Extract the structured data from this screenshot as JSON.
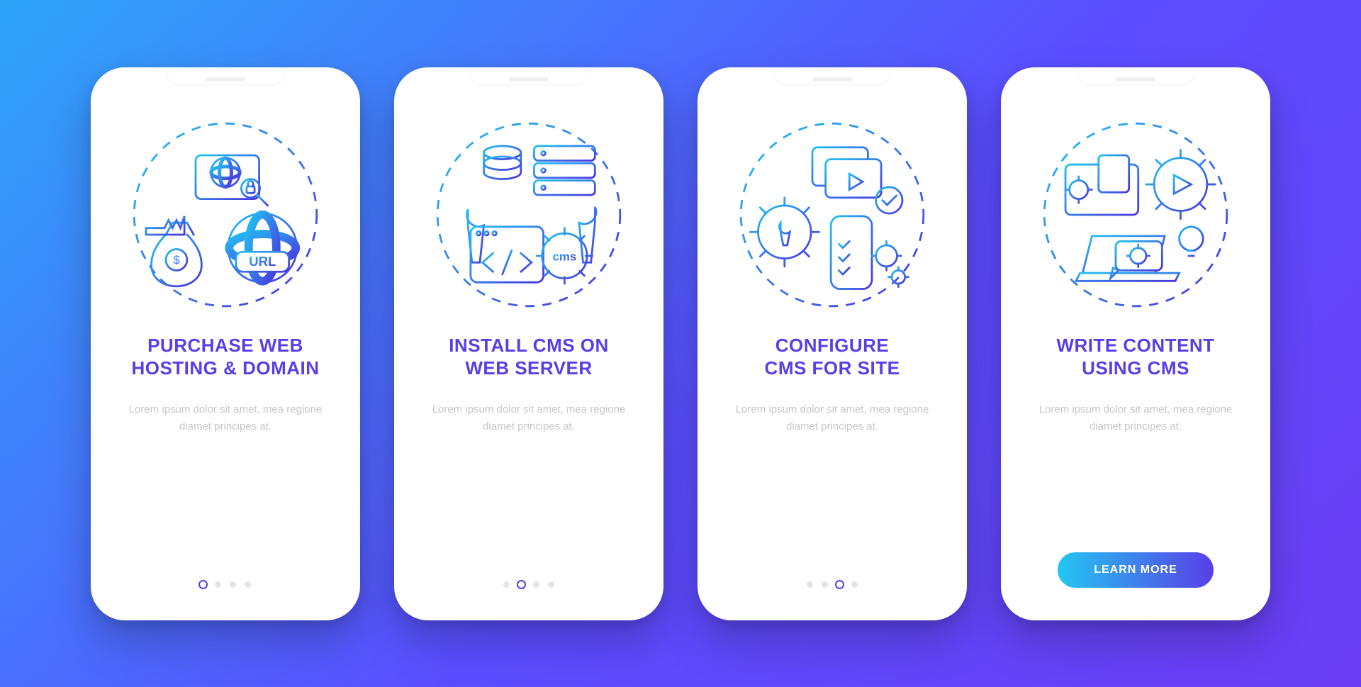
{
  "cta_label": "LEARN MORE",
  "lorem": "Lorem ipsum dolor sit amet, mea regione diamet principes at.",
  "screens": [
    {
      "title": "PURCHASE WEB\nHOSTING & DOMAIN",
      "active_dot": 0
    },
    {
      "title": "INSTALL CMS ON\nWEB SERVER",
      "active_dot": 1
    },
    {
      "title": "CONFIGURE\nCMS FOR SITE",
      "active_dot": 2
    },
    {
      "title": "WRITE CONTENT\nUSING CMS",
      "active_dot": 3
    }
  ]
}
